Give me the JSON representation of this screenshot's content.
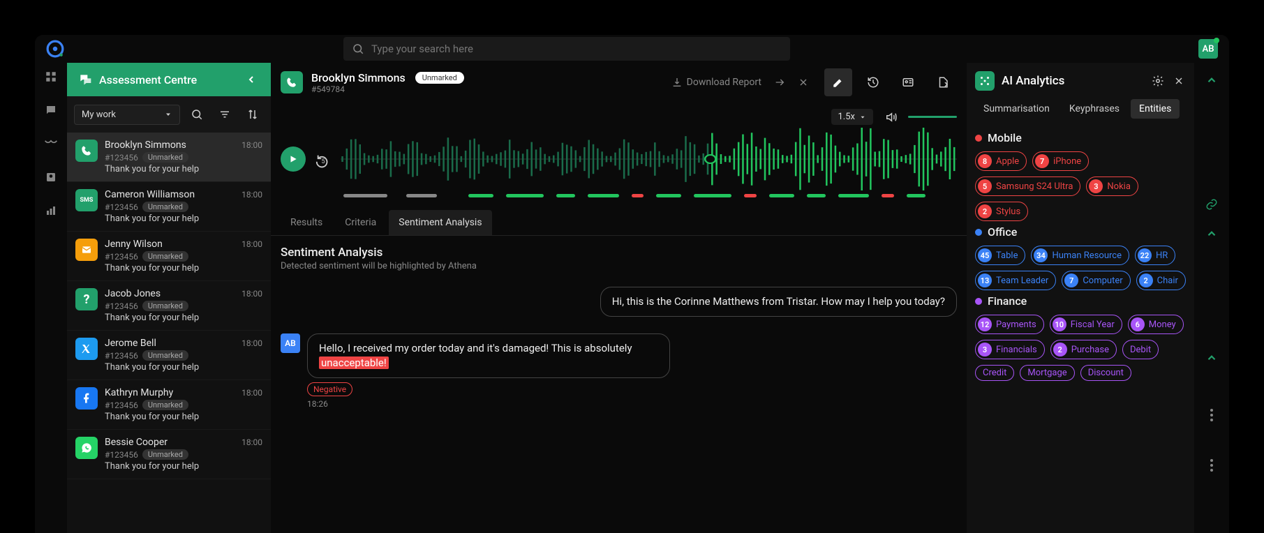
{
  "search": {
    "placeholder": "Type your search here"
  },
  "user": {
    "initials": "AB"
  },
  "sidebar": {
    "title": "Assessment Centre",
    "filter_label": "My work",
    "items": [
      {
        "name": "Brooklyn Simmons",
        "id": "#123456",
        "status": "Unmarked",
        "preview": "Thank you for your help",
        "time": "18:00",
        "icon": "phone",
        "color": "#22a06b",
        "active": true
      },
      {
        "name": "Cameron Williamson",
        "id": "#123456",
        "status": "Unmarked",
        "preview": "Thank you for your help",
        "time": "18:00",
        "icon": "sms",
        "color": "#22a06b",
        "active": false
      },
      {
        "name": "Jenny Wilson",
        "id": "#123456",
        "status": "Unmarked",
        "preview": "Thank you for your help",
        "time": "18:00",
        "icon": "mail",
        "color": "#f59e0b",
        "active": false
      },
      {
        "name": "Jacob Jones",
        "id": "#123456",
        "status": "Unmarked",
        "preview": "Thank you for your help",
        "time": "18:00",
        "icon": "question",
        "color": "#22a06b",
        "active": false
      },
      {
        "name": "Jerome Bell",
        "id": "#123456",
        "status": "Unmarked",
        "preview": "Thank you for your help",
        "time": "18:00",
        "icon": "x",
        "color": "#1d9bf0",
        "active": false
      },
      {
        "name": "Kathryn Murphy",
        "id": "#123456",
        "status": "Unmarked",
        "preview": "Thank you for your help",
        "time": "18:00",
        "icon": "facebook",
        "color": "#1877f2",
        "active": false
      },
      {
        "name": "Bessie Cooper",
        "id": "#123456",
        "status": "Unmarked",
        "preview": "Thank you for your help",
        "time": "18:00",
        "icon": "whatsapp",
        "color": "#25d366",
        "active": false
      }
    ]
  },
  "center": {
    "name": "Brooklyn Simmons",
    "status": "Unmarked",
    "id": "#549784",
    "download": "Download Report",
    "speed": "1.5x",
    "tabs": [
      "Results",
      "Criteria",
      "Sentiment Analysis"
    ],
    "active_tab": 2,
    "section_title": "Sentiment Analysis",
    "section_sub": "Detected sentiment will be highlighted by Athena",
    "messages": [
      {
        "side": "right",
        "text": "Hi, this is the Corinne Matthews from Tristar. How may I help you today?"
      },
      {
        "side": "left",
        "avatar": "AB",
        "text_pre": "Hello, I received my order today and it's damaged! This is absolutely ",
        "highlight": "unacceptable!",
        "sentiment": "Negative",
        "time": "18:26"
      }
    ]
  },
  "ai": {
    "title": "AI Analytics",
    "tabs": [
      "Summarisation",
      "Keyphrases",
      "Entities"
    ],
    "active_tab": 2,
    "sections": [
      {
        "title": "Mobile",
        "color": "#ef4444",
        "cls": "red",
        "chips": [
          {
            "c": 8,
            "t": "Apple"
          },
          {
            "c": 7,
            "t": "iPhone"
          },
          {
            "c": 5,
            "t": "Samsung S24 Ultra"
          },
          {
            "c": 3,
            "t": "Nokia"
          },
          {
            "c": 2,
            "t": "Stylus"
          }
        ]
      },
      {
        "title": "Office",
        "color": "#3b82f6",
        "cls": "blue",
        "chips": [
          {
            "c": 45,
            "t": "Table"
          },
          {
            "c": 34,
            "t": "Human Resource"
          },
          {
            "c": 22,
            "t": "HR"
          },
          {
            "c": 13,
            "t": "Team Leader"
          },
          {
            "c": 7,
            "t": "Computer"
          },
          {
            "c": 2,
            "t": "Chair"
          }
        ]
      },
      {
        "title": "Finance",
        "color": "#a855f7",
        "cls": "purple",
        "chips": [
          {
            "c": 12,
            "t": "Payments"
          },
          {
            "c": 10,
            "t": "Fiscal Year"
          },
          {
            "c": 6,
            "t": "Money"
          },
          {
            "c": 3,
            "t": "Financials"
          },
          {
            "c": 2,
            "t": "Purchase"
          },
          {
            "t": "Debit"
          },
          {
            "t": "Credit"
          },
          {
            "t": "Mortgage"
          },
          {
            "t": "Discount"
          }
        ]
      }
    ]
  }
}
